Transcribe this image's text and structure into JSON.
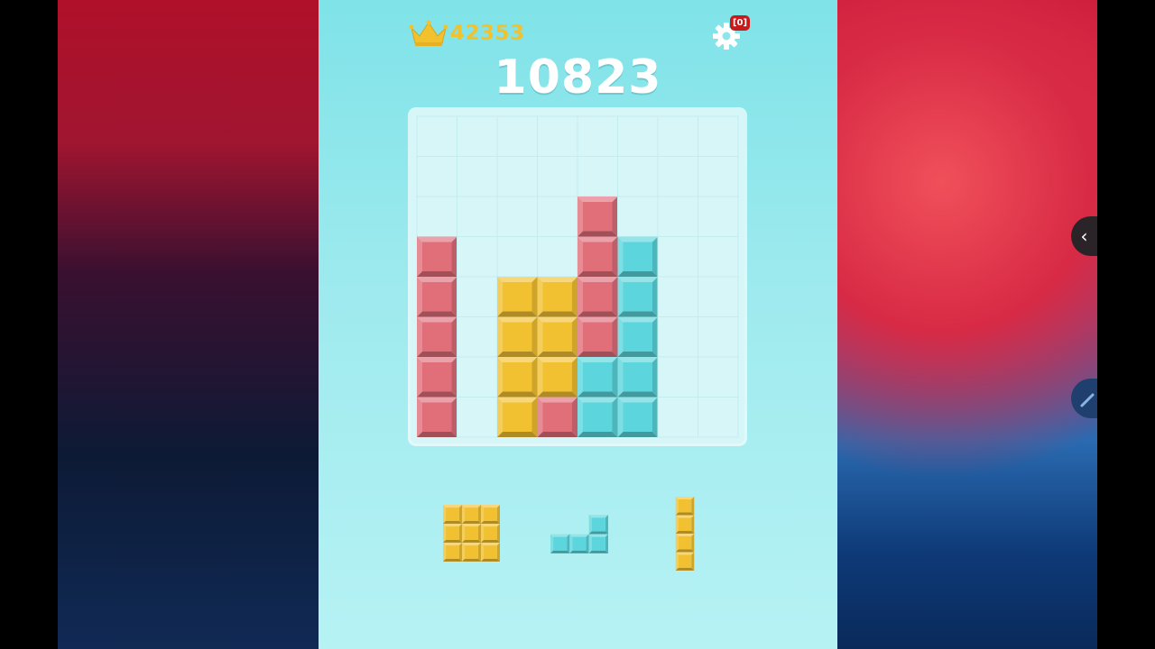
{
  "header": {
    "best_score": "42353",
    "score": "10823",
    "notification_badge": "[0]"
  },
  "colors": {
    "pink": "#e06f7a",
    "yellow": "#f2c132",
    "cyan": "#5cd6dc",
    "empty": "#d7f6f8",
    "grid_line": "#c3ecef"
  },
  "icons": {
    "best": "crown-icon",
    "settings": "gear-icon",
    "side_handle": "chevron-left-icon",
    "pen_handle": "pen-icon"
  },
  "board": {
    "rows": 8,
    "cols": 8,
    "cells": [
      [
        "",
        "",
        "",
        "",
        "",
        "",
        "",
        ""
      ],
      [
        "",
        "",
        "",
        "",
        "",
        "",
        "",
        ""
      ],
      [
        "",
        "",
        "",
        "",
        "pink",
        "",
        "",
        ""
      ],
      [
        "pink",
        "",
        "",
        "",
        "pink",
        "cyan",
        "",
        ""
      ],
      [
        "pink",
        "",
        "yellow",
        "yellow",
        "pink",
        "cyan",
        "",
        ""
      ],
      [
        "pink",
        "",
        "yellow",
        "yellow",
        "pink",
        "cyan",
        "",
        ""
      ],
      [
        "pink",
        "",
        "yellow",
        "yellow",
        "cyan",
        "cyan",
        "",
        ""
      ],
      [
        "pink",
        "",
        "yellow",
        "pink",
        "cyan",
        "cyan",
        "",
        ""
      ]
    ]
  },
  "tray": [
    {
      "color": "yellow",
      "shape": [
        [
          1,
          1,
          1
        ],
        [
          1,
          1,
          1
        ],
        [
          1,
          1,
          1
        ]
      ]
    },
    {
      "color": "cyan",
      "shape": [
        [
          0,
          0,
          1
        ],
        [
          1,
          1,
          1
        ]
      ]
    },
    {
      "color": "yellow",
      "shape": [
        [
          1
        ],
        [
          1
        ],
        [
          1
        ],
        [
          1
        ]
      ]
    }
  ]
}
